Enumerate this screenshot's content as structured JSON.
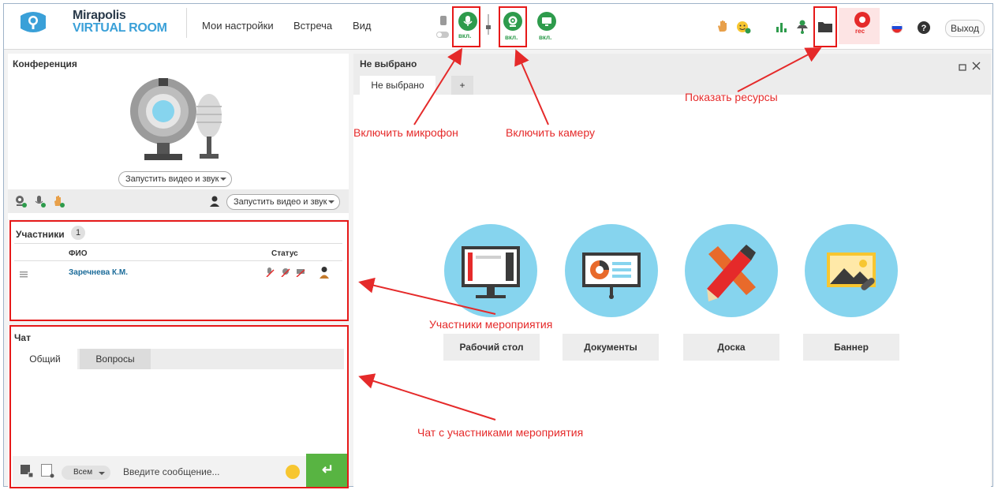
{
  "brand": {
    "line1": "Mirapolis",
    "line2": "VIRTUAL ROOM"
  },
  "menu": [
    "Мои настройки",
    "Встреча",
    "Вид"
  ],
  "toolbar": {
    "mic_state": "вкл.",
    "camera_state": "вкл.",
    "screen_state": "вкл.",
    "rec_label": "rec",
    "exit_label": "Выход"
  },
  "conference": {
    "title": "Конференция",
    "start_button": "Запустить видео и звук",
    "start_button_2": "Запустить видео и звук"
  },
  "participants": {
    "title": "Участники",
    "count": "1",
    "col_name": "ФИО",
    "col_status": "Статус",
    "rows": [
      {
        "name": "Заречнева К.М."
      }
    ]
  },
  "chat": {
    "title": "Чат",
    "tabs": [
      "Общий",
      "Вопросы"
    ],
    "recipient": "Всем",
    "placeholder": "Введите сообщение...",
    "send_symbol": "↵"
  },
  "workspace": {
    "title": "Не выбрано",
    "tab_label": "Не выбрано",
    "add_tab": "+",
    "resources": [
      "Рабочий стол",
      "Документы",
      "Доска",
      "Баннер"
    ]
  },
  "annotations": {
    "mic": "Включить микрофон",
    "camera": "Включить камеру",
    "resources": "Показать ресурсы",
    "participants": "Участники мероприятия",
    "chat": "Чат с участниками мероприятия"
  },
  "colors": {
    "accent_green": "#2e9b4c",
    "annotation_red": "#e52a2a",
    "resource_blue": "#86d4ee",
    "link_blue": "#1c6c9a"
  }
}
